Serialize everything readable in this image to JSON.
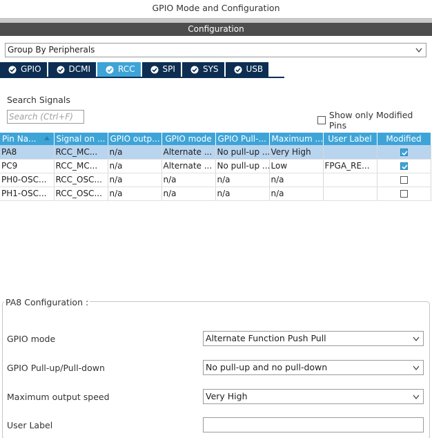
{
  "window": {
    "title": "GPIO Mode and Configuration"
  },
  "config_header": "Configuration",
  "group_by": {
    "value": "Group By Peripherals"
  },
  "tabs": [
    {
      "label": "GPIO",
      "active": false
    },
    {
      "label": "DCMI",
      "active": false
    },
    {
      "label": "RCC",
      "active": true
    },
    {
      "label": "SPI",
      "active": false
    },
    {
      "label": "SYS",
      "active": false
    },
    {
      "label": "USB",
      "active": false
    }
  ],
  "search": {
    "label": "Search Signals",
    "placeholder": "Search (Ctrl+F)",
    "value": ""
  },
  "show_modified": {
    "label": "Show only Modified Pins",
    "checked": false
  },
  "table": {
    "columns": [
      "Pin Na...",
      "Signal on ...",
      "GPIO outp...",
      "GPIO mode",
      "GPIO Pull-...",
      "Maximum ...",
      "User Label",
      "Modified"
    ],
    "rows": [
      {
        "cells": [
          "PA8",
          "RCC_MC...",
          "n/a",
          "Alternate ...",
          "No pull-up ...",
          "Very High",
          ""
        ],
        "modified": true,
        "selected": true
      },
      {
        "cells": [
          "PC9",
          "RCC_MC...",
          "n/a",
          "Alternate ...",
          "No pull-up ...",
          "Low",
          "FPGA_RE..."
        ],
        "modified": true,
        "selected": false
      },
      {
        "cells": [
          "PH0-OSC...",
          "RCC_OSC...",
          "n/a",
          "n/a",
          "n/a",
          "n/a",
          ""
        ],
        "modified": false,
        "selected": false
      },
      {
        "cells": [
          "PH1-OSC...",
          "RCC_OSC...",
          "n/a",
          "n/a",
          "n/a",
          "n/a",
          ""
        ],
        "modified": false,
        "selected": false
      }
    ]
  },
  "pin_config": {
    "title": "PA8 Configuration :",
    "gpio_mode": {
      "label": "GPIO mode",
      "value": "Alternate Function Push Pull"
    },
    "pull": {
      "label": "GPIO Pull-up/Pull-down",
      "value": "No pull-up and no pull-down"
    },
    "speed": {
      "label": "Maximum output speed",
      "value": "Very High"
    },
    "user_label": {
      "label": "User Label",
      "value": ""
    }
  },
  "colors": {
    "accent": "#3ea4d8",
    "tab_bg": "#0d2e52",
    "header_bar": "#4d4d4d",
    "selected_row": "#b8d4ee"
  }
}
